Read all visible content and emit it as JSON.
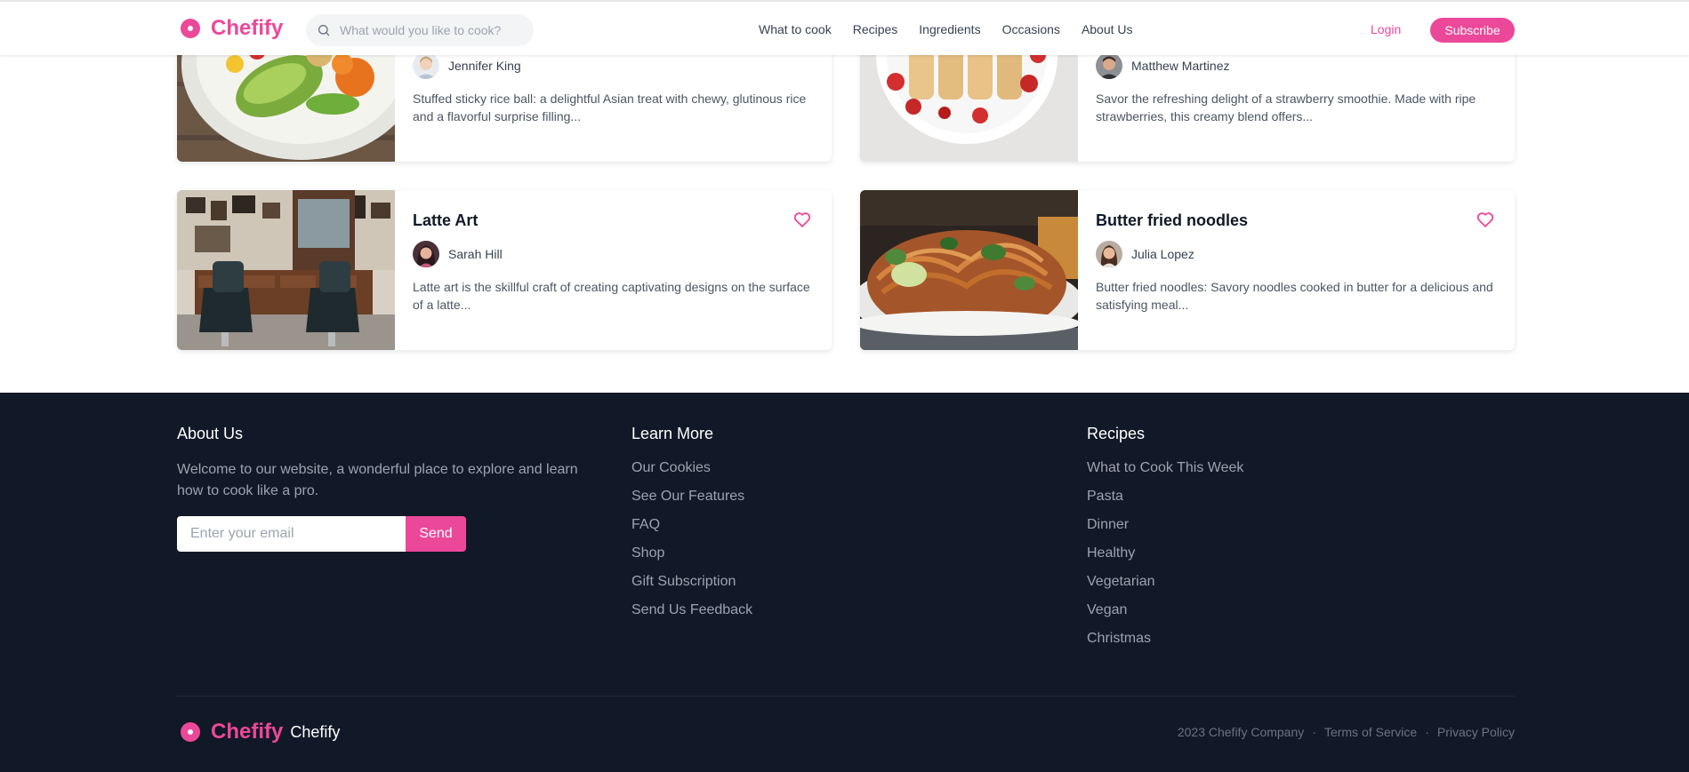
{
  "header": {
    "logo_text": "Chefify",
    "search_placeholder": "What would you like to cook?",
    "nav": [
      "What to cook",
      "Recipes",
      "Ingredients",
      "Occasions",
      "About Us"
    ],
    "login": "Login",
    "subscribe": "Subscribe"
  },
  "cards": [
    {
      "title": "",
      "author": "Jennifer King",
      "description": "Stuffed sticky rice ball: a delightful Asian treat with chewy, glutinous rice and a flavorful surprise filling..."
    },
    {
      "title": "",
      "author": "Matthew Martinez",
      "description": "Savor the refreshing delight of a strawberry smoothie. Made with ripe strawberries, this creamy blend offers..."
    },
    {
      "title": "Latte Art",
      "author": "Sarah Hill",
      "description": "Latte art is the skillful craft of creating captivating designs on the surface of a latte..."
    },
    {
      "title": "Butter fried noodles",
      "author": "Julia Lopez",
      "description": "Butter fried noodles: Savory noodles cooked in butter for a delicious and satisfying meal..."
    }
  ],
  "footer": {
    "about": {
      "title": "About Us",
      "text": "Welcome to our website, a wonderful place to explore and learn how to cook like a pro.",
      "email_placeholder": "Enter your email",
      "send": "Send"
    },
    "learn_more": {
      "title": "Learn More",
      "links": [
        "Our Cookies",
        "See Our Features",
        "FAQ",
        "Shop",
        "Gift Subscription",
        "Send Us Feedback"
      ]
    },
    "recipes": {
      "title": "Recipes",
      "links": [
        "What to Cook This Week",
        "Pasta",
        "Dinner",
        "Healthy",
        "Vegetarian",
        "Vegan",
        "Christmas"
      ]
    },
    "brand": "Chefify",
    "brand_sub": "Chefify",
    "copyright": "2023 Chefify Company",
    "terms": "Terms of Service",
    "privacy": "Privacy Policy",
    "separator": "·"
  },
  "colors": {
    "accent": "#ec4899",
    "footer_bg": "#111827",
    "text": "#374151"
  }
}
